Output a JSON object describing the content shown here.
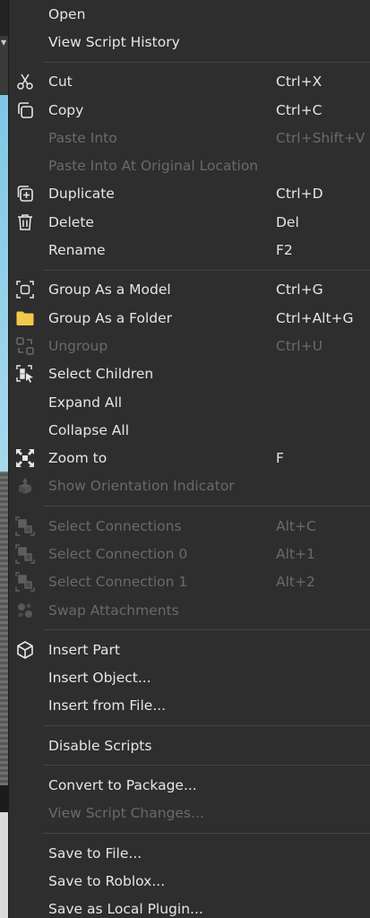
{
  "menu": {
    "open": {
      "label": "Open"
    },
    "view_script_history": {
      "label": "View Script History"
    },
    "cut": {
      "label": "Cut",
      "shortcut": "Ctrl+X",
      "icon": "scissors-icon"
    },
    "copy": {
      "label": "Copy",
      "shortcut": "Ctrl+C",
      "icon": "copy-icon"
    },
    "paste_into": {
      "label": "Paste Into",
      "shortcut": "Ctrl+Shift+V",
      "disabled": true
    },
    "paste_into_original": {
      "label": "Paste Into At Original Location",
      "disabled": true
    },
    "duplicate": {
      "label": "Duplicate",
      "shortcut": "Ctrl+D",
      "icon": "duplicate-icon"
    },
    "delete": {
      "label": "Delete",
      "shortcut": "Del",
      "icon": "trash-icon"
    },
    "rename": {
      "label": "Rename",
      "shortcut": "F2"
    },
    "group_model": {
      "label": "Group As a Model",
      "shortcut": "Ctrl+G",
      "icon": "group-model-icon"
    },
    "group_folder": {
      "label": "Group As a Folder",
      "shortcut": "Ctrl+Alt+G",
      "icon": "folder-icon"
    },
    "ungroup": {
      "label": "Ungroup",
      "shortcut": "Ctrl+U",
      "icon": "ungroup-icon",
      "disabled": true
    },
    "select_children": {
      "label": "Select Children",
      "icon": "select-children-icon"
    },
    "expand_all": {
      "label": "Expand All"
    },
    "collapse_all": {
      "label": "Collapse All"
    },
    "zoom_to": {
      "label": "Zoom to",
      "shortcut": "F",
      "icon": "zoom-to-icon"
    },
    "show_orientation": {
      "label": "Show Orientation Indicator",
      "icon": "orientation-icon",
      "disabled": true
    },
    "select_connections": {
      "label": "Select Connections",
      "shortcut": "Alt+C",
      "icon": "connections-icon",
      "disabled": true
    },
    "select_connection_0": {
      "label": "Select Connection 0",
      "shortcut": "Alt+1",
      "icon": "connections-icon",
      "disabled": true
    },
    "select_connection_1": {
      "label": "Select Connection 1",
      "shortcut": "Alt+2",
      "icon": "connections-icon",
      "disabled": true
    },
    "swap_attachments": {
      "label": "Swap Attachments",
      "icon": "swap-attachments-icon",
      "disabled": true
    },
    "insert_part": {
      "label": "Insert Part",
      "icon": "part-cube-icon"
    },
    "insert_object": {
      "label": "Insert Object..."
    },
    "insert_from_file": {
      "label": "Insert from File..."
    },
    "disable_scripts": {
      "label": "Disable Scripts"
    },
    "convert_package": {
      "label": "Convert to Package..."
    },
    "view_script_changes": {
      "label": "View Script Changes...",
      "disabled": true
    },
    "save_to_file": {
      "label": "Save to File..."
    },
    "save_to_roblox": {
      "label": "Save to Roblox..."
    },
    "save_local_plugin": {
      "label": "Save as Local Plugin..."
    }
  },
  "colors": {
    "menu_bg": "#2e2e2e",
    "text": "#e6e6e6",
    "text_disabled": "#6a6a6a",
    "separator": "#454545",
    "folder": "#f2c94c"
  }
}
